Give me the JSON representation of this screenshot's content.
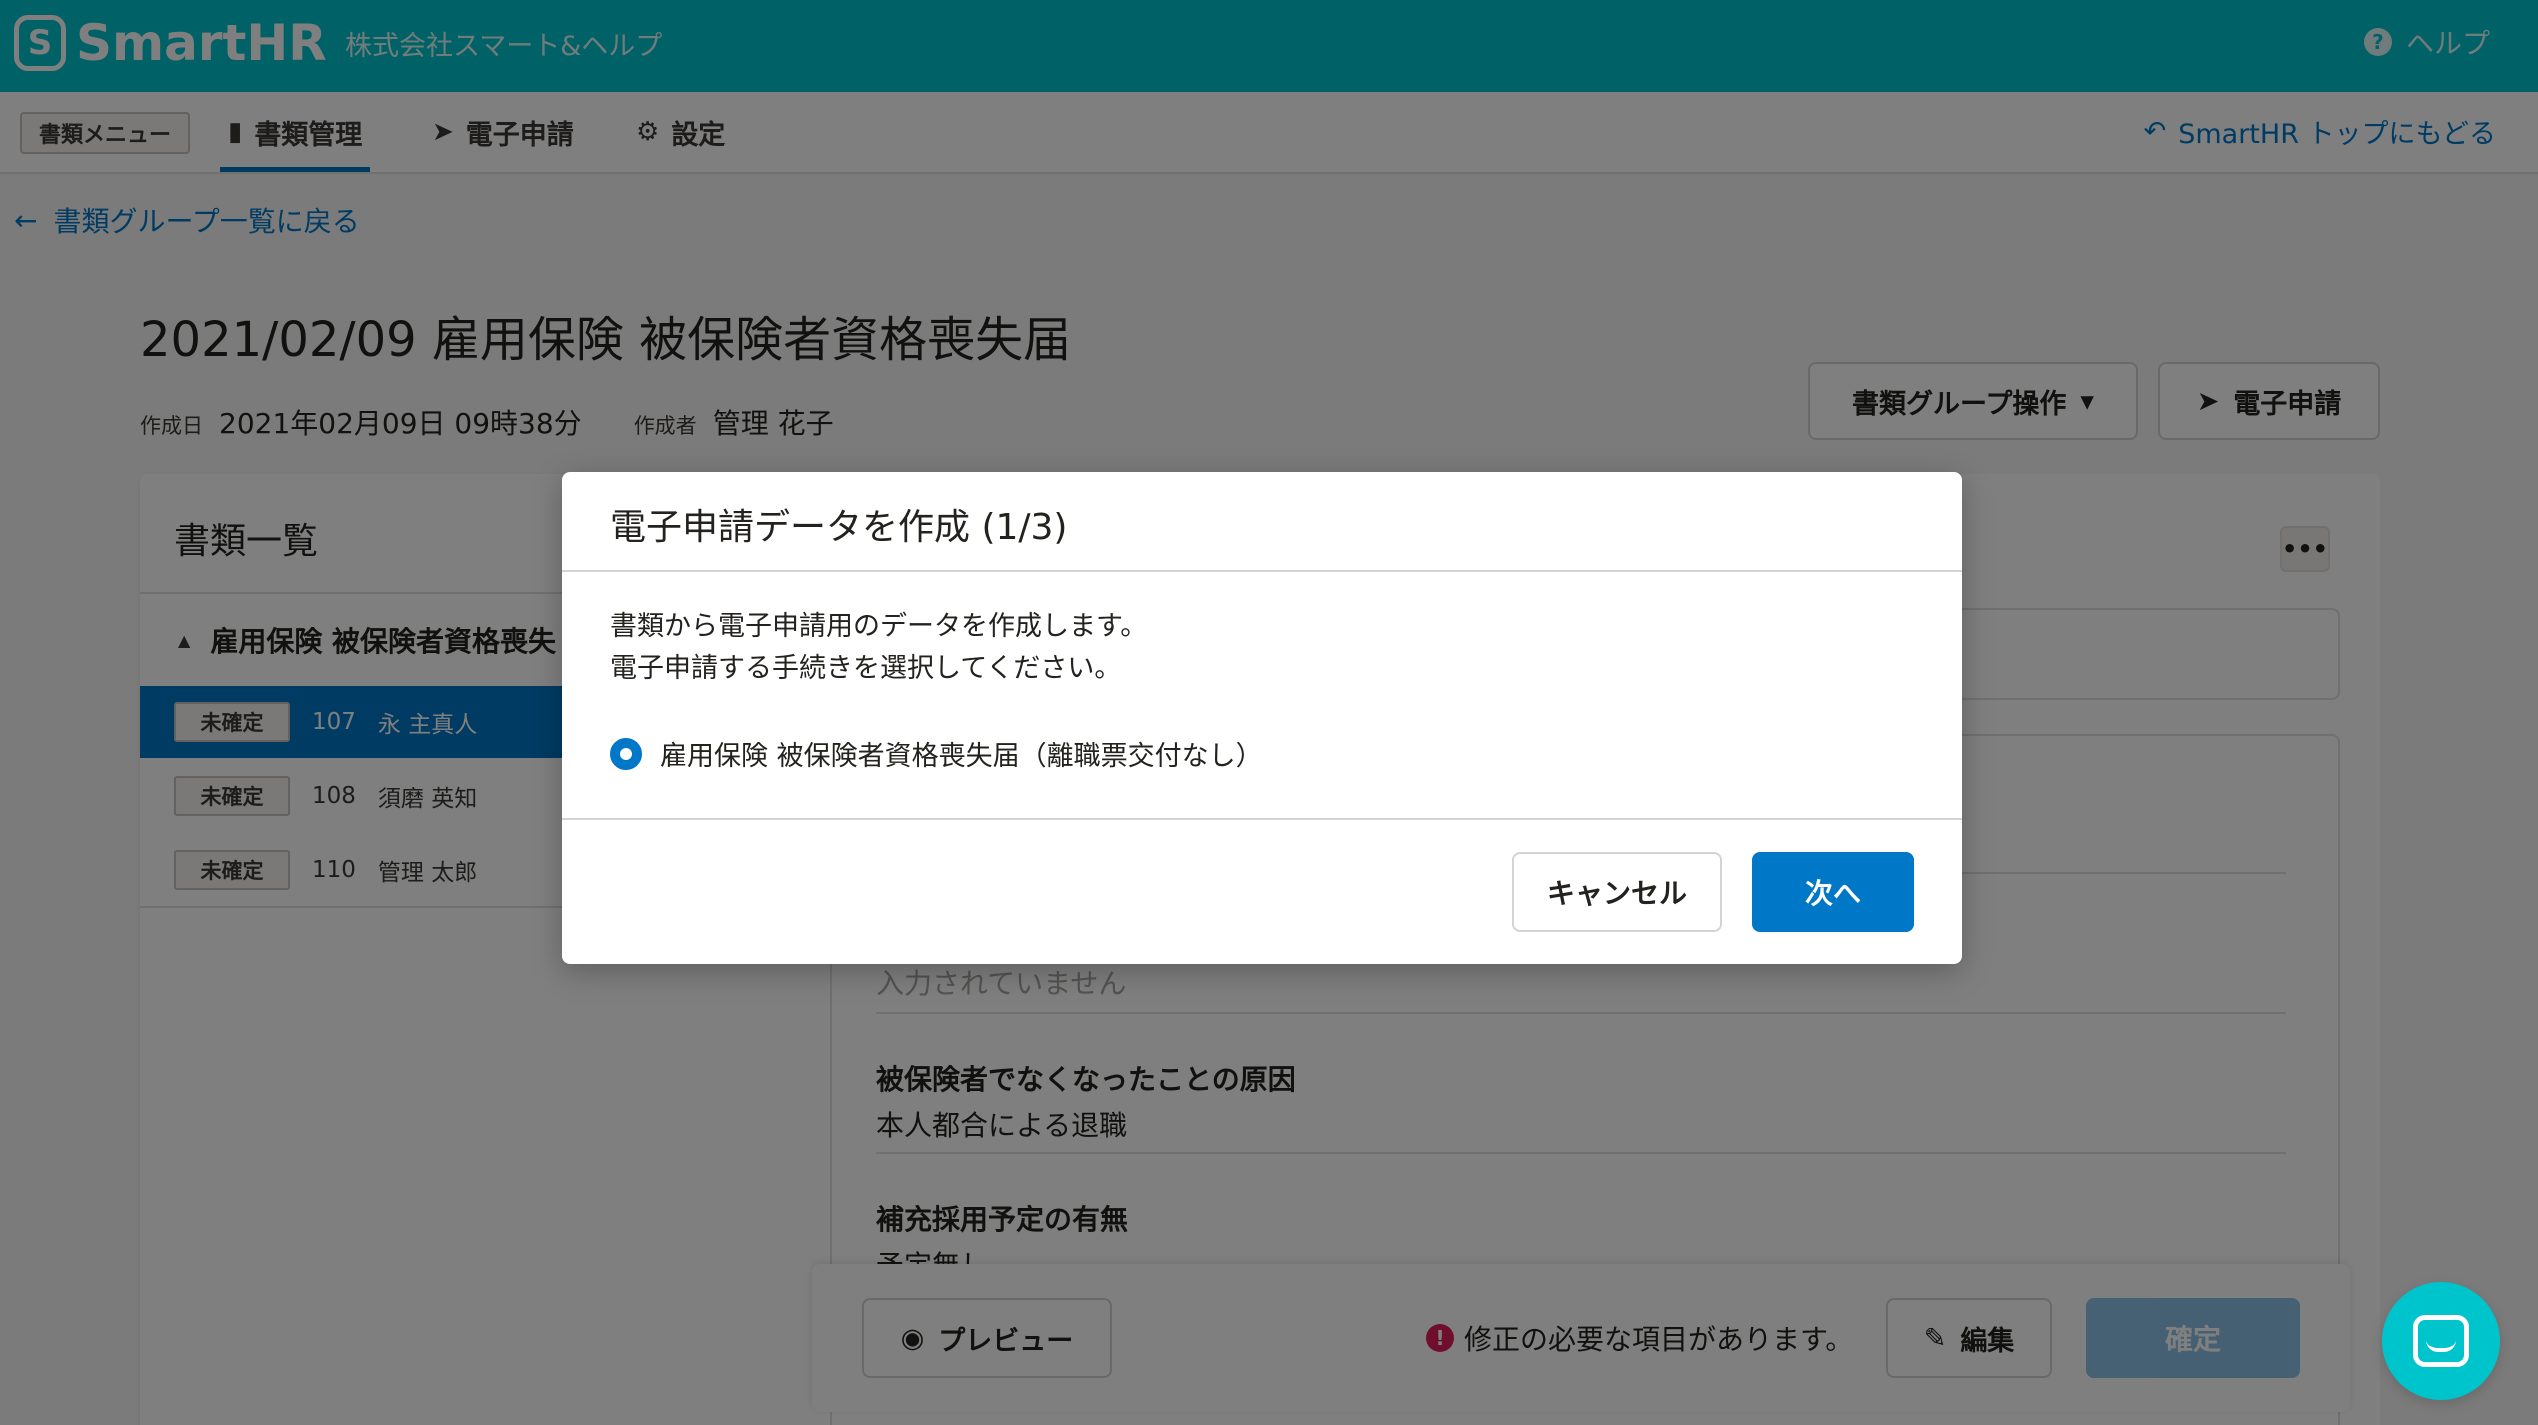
{
  "header": {
    "logo_mark": "S",
    "logo_text": "SmartHR",
    "company": "株式会社スマート&ヘルプ",
    "help_label": "ヘルプ"
  },
  "subnav": {
    "menu_label": "書類メニュー",
    "tabs": [
      {
        "label": "書類管理",
        "icon": "document-icon",
        "active": true
      },
      {
        "label": "電子申請",
        "icon": "paper-plane-icon",
        "active": false
      },
      {
        "label": "設定",
        "icon": "gear-icon",
        "active": false
      }
    ],
    "back_top_label": "SmartHR トップにもどる"
  },
  "back_link": "書類グループ一覧に戻る",
  "page": {
    "title": "2021/02/09 雇用保険 被保険者資格喪失届",
    "created_label": "作成日",
    "created_value": "2021年02月09日 09時38分",
    "author_label": "作成者",
    "author_value": "管理 花子",
    "group_ops_label": "書類グループ操作",
    "e_apply_label": "電子申請"
  },
  "left_panel": {
    "title": "書類一覧",
    "group_label": "雇用保険 被保険者資格喪失",
    "rows": [
      {
        "status": "未確定",
        "id": "107",
        "name": "永 主真人",
        "selected": true
      },
      {
        "status": "未確定",
        "id": "108",
        "name": "須磨 英知",
        "selected": false
      },
      {
        "status": "未確定",
        "id": "110",
        "name": "管理 太郎",
        "selected": false
      }
    ]
  },
  "right_panel": {
    "more_label": "•••",
    "empty_value": "入力されていません",
    "field1_label": "被保険者でなくなったことの原因",
    "field1_value": "本人都合による退職",
    "field2_label": "補充採用予定の有無",
    "field2_value": "予定無し",
    "field3_value": "入力されていません"
  },
  "footer": {
    "preview_label": "プレビュー",
    "warning_text": "修正の必要な項目があります。",
    "edit_label": "編集",
    "confirm_label": "確定"
  },
  "modal": {
    "title": "電子申請データを作成 (1/3)",
    "desc_line1": "書類から電子申請用のデータを作成します。",
    "desc_line2": "電子申請する手続きを選択してください。",
    "option_label": "雇用保険 被保険者資格喪失届（離職票交付なし）",
    "cancel_label": "キャンセル",
    "next_label": "次へ"
  },
  "colors": {
    "brand": "#00c4cc",
    "primary": "#0077c7",
    "danger": "#e01e5a"
  }
}
